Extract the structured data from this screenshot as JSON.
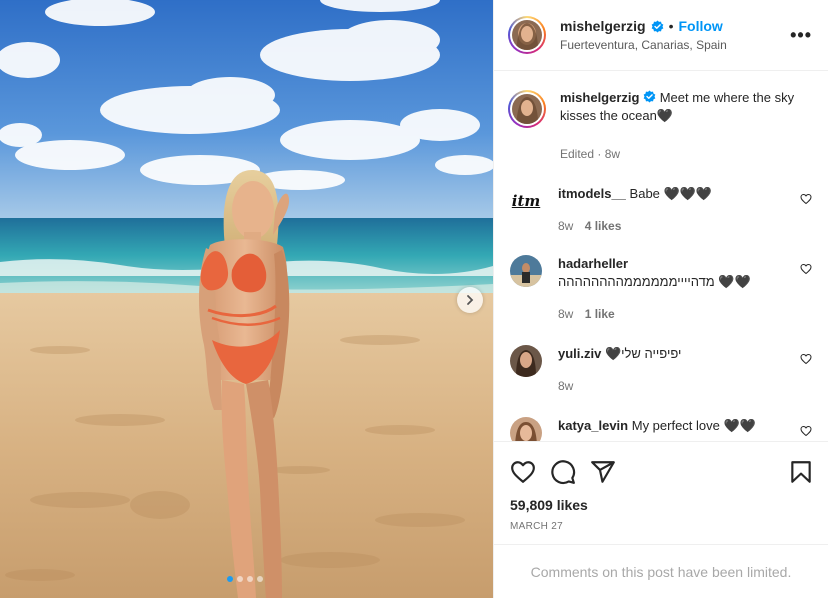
{
  "post": {
    "username": "mishelgerzig",
    "follow_label": "Follow",
    "separator": "•",
    "location": "Fuerteventura, Canarias, Spain",
    "more_label": "•••"
  },
  "caption": {
    "username": "mishelgerzig",
    "text": "Meet me where the sky kisses the ocean🖤",
    "edited": "Edited",
    "age": "8w"
  },
  "comments": [
    {
      "username": "itmodels__",
      "text": "Babe 🖤🖤🖤",
      "age": "8w",
      "likes": "4 likes"
    },
    {
      "username": "hadarheller",
      "text": "מדהייייממממממהההההההה 🖤🖤",
      "age": "8w",
      "likes": "1 like"
    },
    {
      "username": "yuli.ziv",
      "text": "יפיפייה שלי🖤",
      "age": "8w",
      "likes": ""
    },
    {
      "username": "katya_levin",
      "text": "My perfect love 🖤🖤",
      "age": "",
      "likes": ""
    }
  ],
  "itm_logo": "itm",
  "likes_count": "59,809 likes",
  "post_date": "MARCH 27",
  "comments_limited": "Comments on this post have been limited.",
  "colors": {
    "follow": "#0095f6",
    "verified": "#0095f6",
    "sky": "#3f7fd1",
    "sea": "#2fa2b4",
    "sand": "#d9b68a",
    "bikini": "#e8663e"
  },
  "icons": [
    "verified-badge-icon",
    "heart-icon",
    "comment-icon",
    "share-icon",
    "bookmark-icon",
    "chevron-right-icon"
  ],
  "carousel": {
    "total": 4,
    "active_index": 0
  }
}
